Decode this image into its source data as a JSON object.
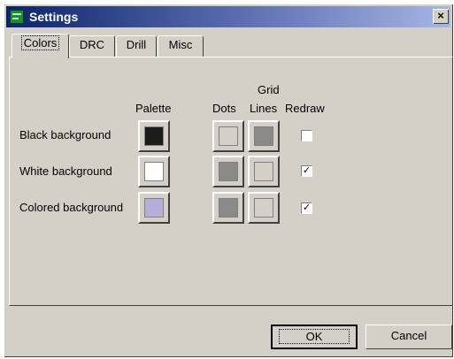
{
  "window": {
    "title": "Settings",
    "close_glyph": "×"
  },
  "tabs": [
    {
      "label": "Colors",
      "active": true
    },
    {
      "label": "DRC",
      "active": false
    },
    {
      "label": "Drill",
      "active": false
    },
    {
      "label": "Misc",
      "active": false
    }
  ],
  "columns": {
    "palette": "Palette",
    "dots": "Dots",
    "grid_top": "Grid",
    "lines": "Lines",
    "redraw": "Redraw"
  },
  "rows": [
    {
      "label": "Black background",
      "palette_color": "#1c1c1c",
      "dots_color": "#d4d0c8",
      "lines_color": "#8a8a8a",
      "redraw": false
    },
    {
      "label": "White background",
      "palette_color": "#ffffff",
      "dots_color": "#8a8a8a",
      "lines_color": "#d4d0c8",
      "redraw": true
    },
    {
      "label": "Colored background",
      "palette_color": "#b4aed8",
      "dots_color": "#8a8a8a",
      "lines_color": "#d4d0c8",
      "redraw": true
    }
  ],
  "buttons": {
    "ok": "OK",
    "cancel": "Cancel"
  },
  "check_glyph": "✓",
  "colors": {
    "face": "#d4d0c8",
    "title_bar": "#0a246a"
  }
}
